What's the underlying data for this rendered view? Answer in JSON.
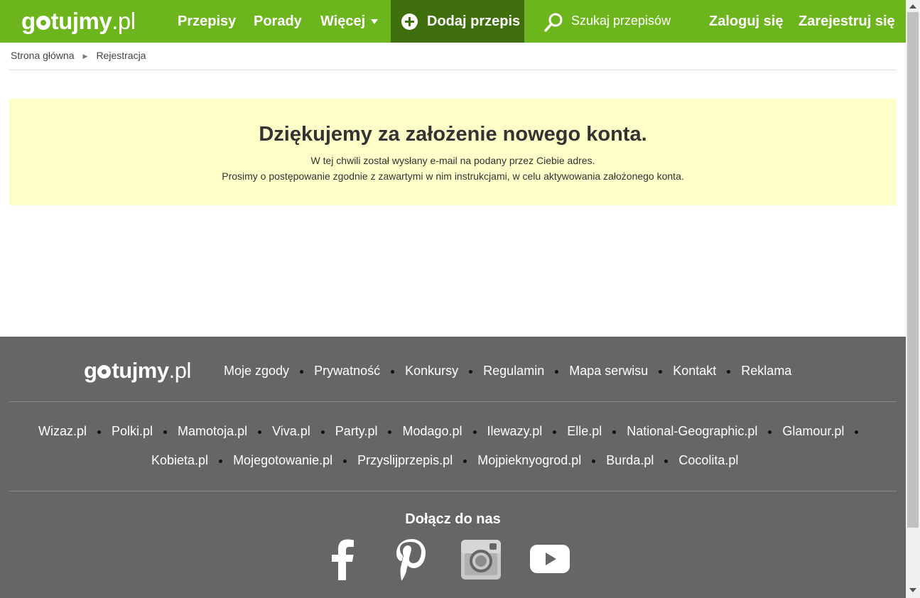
{
  "header": {
    "logo_main": "gotujmy",
    "logo_suffix": ".pl",
    "nav": {
      "recipes": "Przepisy",
      "tips": "Porady",
      "more": "Więcej"
    },
    "add_recipe": "Dodaj przepis",
    "search_placeholder": "Szukaj przepisów",
    "login": "Zaloguj się",
    "register": "Zarejestruj się",
    "brand_color": "#6db51c",
    "add_button_color": "#3f6f0c"
  },
  "breadcrumb": {
    "home": "Strona główna",
    "current": "Rejestracja"
  },
  "notice": {
    "title": "Dziękujemy za założenie nowego konta.",
    "line1": "W tej chwili został wysłany e-mail na podany przez Ciebie adres.",
    "line2": "Prosimy o postępowanie zgodnie z zawartymi w nim instrukcjami, w celu aktywowania założonego konta.",
    "background": "#fefec8"
  },
  "footer": {
    "logo_main": "gotujmy",
    "logo_suffix": ".pl",
    "links": [
      "Moje zgody",
      "Prywatność",
      "Konkursy",
      "Regulamin",
      "Mapa serwisu",
      "Kontakt",
      "Reklama"
    ],
    "partners_row1": [
      "Wizaz.pl",
      "Polki.pl",
      "Mamotoja.pl",
      "Viva.pl",
      "Party.pl",
      "Modago.pl",
      "Ilewazy.pl",
      "Elle.pl",
      "National-Geographic.pl",
      "Glamour.pl"
    ],
    "partners_row2": [
      "Kobieta.pl",
      "Mojegotowanie.pl",
      "Przyslijprzepis.pl",
      "Mojpieknyogrod.pl",
      "Burda.pl",
      "Cocolita.pl"
    ],
    "join_label": "Dołącz do nas",
    "social": [
      "facebook-icon",
      "pinterest-icon",
      "instagram-icon",
      "youtube-icon"
    ],
    "background": "#666666"
  }
}
